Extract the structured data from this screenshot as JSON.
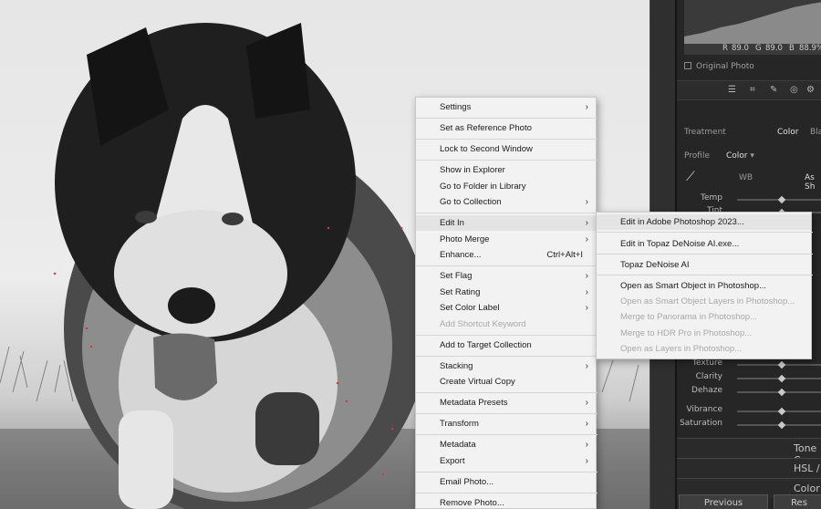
{
  "panel": {
    "rgb": {
      "r_label": "R",
      "r_value": "89.0",
      "g_label": "G",
      "g_value": "89.0",
      "b_label": "B",
      "b_value": "88.9",
      "unit": "%"
    },
    "original_photo": "Original Photo",
    "treatment_label": "Treatment",
    "treatment_value": "Color",
    "treatment_alt": "Black",
    "profile_label": "Profile",
    "profile_value": "Color",
    "wb_label": "WB",
    "wb_value": "As Sh",
    "sliders": [
      {
        "label": "Temp",
        "level": 0.52
      },
      {
        "label": "Tint",
        "level": 0.52
      },
      {
        "label": "Texture",
        "level": 0.52
      },
      {
        "label": "Clarity",
        "level": 0.52
      },
      {
        "label": "Dehaze",
        "level": 0.52
      },
      {
        "label": "Vibrance",
        "level": 0.52
      },
      {
        "label": "Saturation",
        "level": 0.52
      }
    ],
    "sections": {
      "tone": "Tone C",
      "hsl": "HSL /",
      "color_grading": "Color Gr"
    },
    "previous_button": "Previous",
    "reset_button": "Res"
  },
  "context_menu": {
    "items": [
      {
        "label": "Settings",
        "submenu": true
      },
      {
        "label": "Set as Reference Photo"
      },
      {
        "label": "Lock to Second Window"
      },
      {
        "label": "Show in Explorer"
      },
      {
        "label": "Go to Folder in Library"
      },
      {
        "label": "Go to Collection",
        "submenu": true
      },
      {
        "label": "Edit In",
        "submenu": true,
        "highlighted": true
      },
      {
        "label": "Photo Merge",
        "submenu": true
      },
      {
        "label": "Enhance...",
        "shortcut": "Ctrl+Alt+I"
      },
      {
        "label": "Set Flag",
        "submenu": true
      },
      {
        "label": "Set Rating",
        "submenu": true
      },
      {
        "label": "Set Color Label",
        "submenu": true
      },
      {
        "label": "Add Shortcut Keyword",
        "disabled": true
      },
      {
        "label": "Add to Target Collection"
      },
      {
        "label": "Stacking",
        "submenu": true
      },
      {
        "label": "Create Virtual Copy"
      },
      {
        "label": "Metadata Presets",
        "submenu": true
      },
      {
        "label": "Transform",
        "submenu": true
      },
      {
        "label": "Metadata",
        "submenu": true
      },
      {
        "label": "Export",
        "submenu": true
      },
      {
        "label": "Email Photo..."
      },
      {
        "label": "Remove Photo..."
      }
    ]
  },
  "submenu": {
    "items": [
      {
        "label": "Edit in Adobe Photoshop 2023...",
        "highlighted": true
      },
      {
        "label": "Edit in Topaz DeNoise AI.exe..."
      },
      {
        "label": "Topaz DeNoise AI"
      },
      {
        "label": "Open as Smart Object in Photoshop..."
      },
      {
        "label": "Open as Smart Object Layers in Photoshop...",
        "disabled": true
      },
      {
        "label": "Merge to Panorama in Photoshop...",
        "disabled": true
      },
      {
        "label": "Merge to HDR Pro in Photoshop...",
        "disabled": true
      },
      {
        "label": "Open as Layers in Photoshop...",
        "disabled": true
      }
    ]
  },
  "icons": {
    "submenu_arrow": "chevron-right-icon",
    "eyedropper": "eyedropper-icon",
    "panel_tools": [
      "sliders-icon",
      "crop-icon",
      "brush-icon",
      "redeye-icon",
      "gear-icon"
    ]
  },
  "colors": {
    "menu_bg": "#f2f2f2",
    "menu_highlight": "#e4e4e4",
    "panel_bg": "#262626",
    "clipping_red": "#d8342f"
  }
}
